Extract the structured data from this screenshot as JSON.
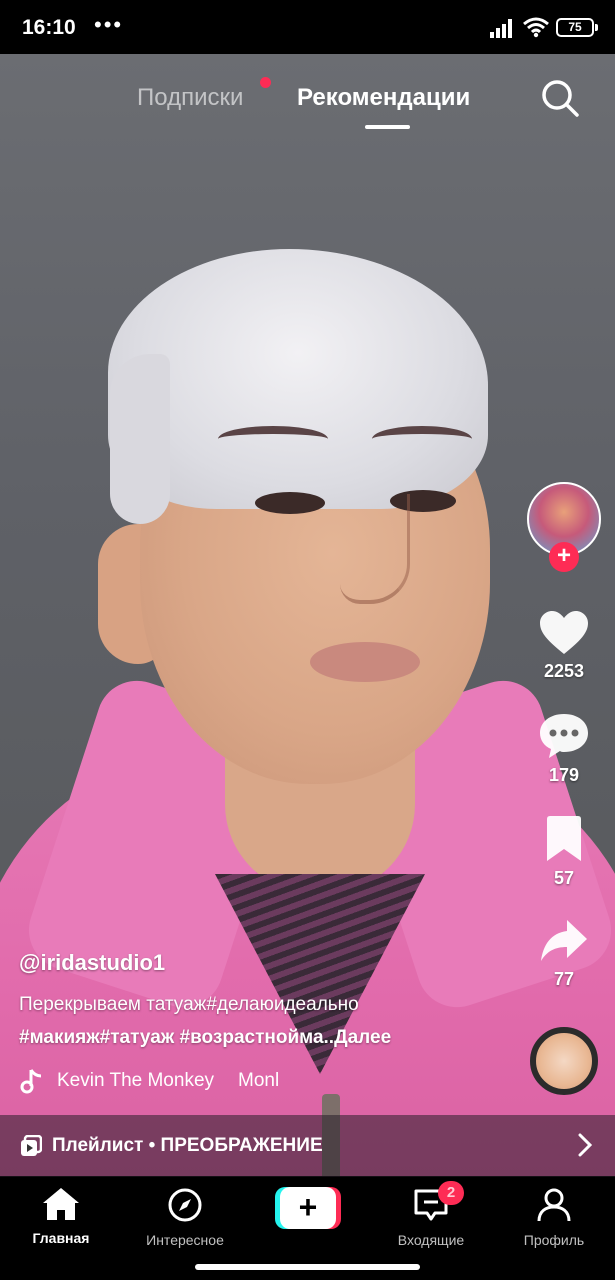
{
  "status_bar": {
    "time": "16:10",
    "dots": "•••",
    "battery": "75"
  },
  "top_tabs": {
    "following": "Подписки",
    "for_you": "Рекомендации"
  },
  "video": {
    "username": "@iridastudio1",
    "description_line1": "Перекрываем татуаж#делаюидеально",
    "description_line2": "#макияж#татуаж #возрастнойма..",
    "more_label": "Далее",
    "music_title": "Kevin The Monkey",
    "music_scroll": "Monl"
  },
  "actions": {
    "likes": "2253",
    "comments": "179",
    "saves": "57",
    "shares": "77"
  },
  "playlist": {
    "label": "Плейлист • ПРЕОБРАЖЕНИЕ"
  },
  "bottom_nav": {
    "home": "Главная",
    "discover": "Интересное",
    "inbox": "Входящие",
    "inbox_badge": "2",
    "profile": "Профиль"
  },
  "colors": {
    "accent": "#fe2c55",
    "cyan": "#25f4ee"
  }
}
